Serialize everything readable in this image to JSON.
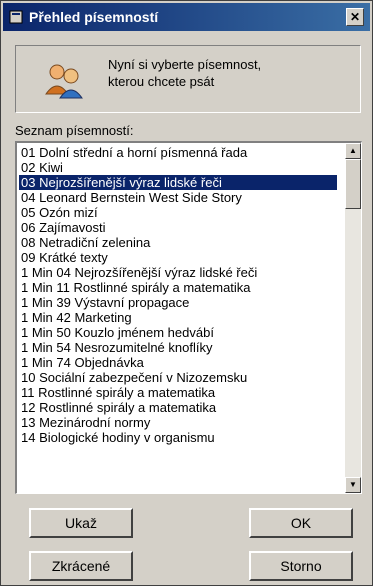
{
  "window": {
    "title": "Přehled písemností",
    "close_label": "✕"
  },
  "info": {
    "line1": "Nyní si vyberte písemnost,",
    "line2": "kterou chcete psát"
  },
  "list": {
    "label": "Seznam písemností:",
    "selected_index": 2,
    "items": [
      "01 Dolní střední a horní písmenná řada",
      "02 Kiwi",
      "03 Nejrozšířenější výraz lidské řeči",
      "04 Leonard Bernstein West Side Story",
      "05 Ozón mizí",
      "06 Zajímavosti",
      "08 Netradiční zelenina",
      "09 Krátké texty",
      "1 Min 04 Nejrozšířenější výraz lidské řeči",
      "1 Min 11 Rostlinné spirály a matematika",
      "1 Min 39 Výstavní propagace",
      "1 Min 42 Marketing",
      "1 Min 50 Kouzlo jménem hedvábí",
      "1 Min 54 Nesrozumitelné knoflíky",
      "1 Min 74 Objednávka",
      "10 Sociální zabezpečení v Nizozemsku",
      "11 Rostlinné spirály a matematika",
      "12 Rostlinné spirály a matematika",
      "13 Mezinárodní normy",
      "14 Biologické hodiny v organismu"
    ]
  },
  "buttons": {
    "show": "Ukaž",
    "ok": "OK",
    "abbreviated": "Zkrácené",
    "cancel": "Storno"
  }
}
